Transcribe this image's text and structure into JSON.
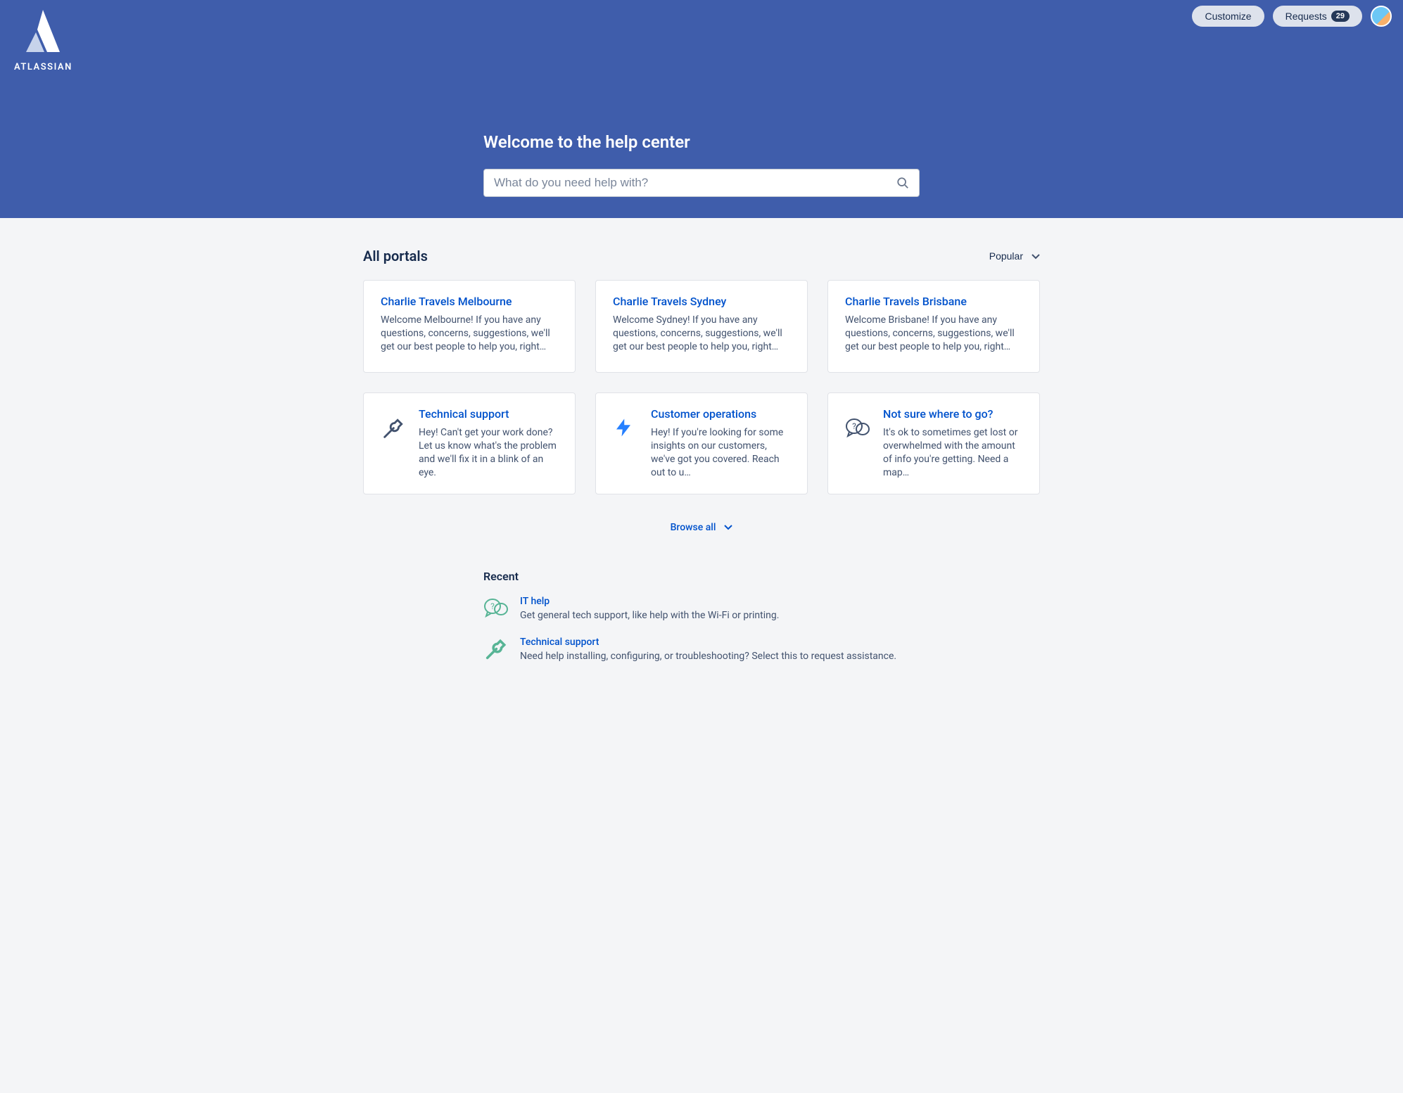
{
  "header": {
    "logo_text": "ATLASSIAN",
    "customize_label": "Customize",
    "requests_label": "Requests",
    "requests_count": "29"
  },
  "hero": {
    "title": "Welcome to the help center",
    "search_placeholder": "What do you need help with?"
  },
  "portals": {
    "heading": "All portals",
    "sort_label": "Popular",
    "browse_all_label": "Browse all",
    "cards": [
      {
        "title": "Charlie Travels Melbourne",
        "desc": "Welcome Melbourne! If you have any questions, concerns, suggestions, we'll get our best people to help you, right…"
      },
      {
        "title": "Charlie Travels Sydney",
        "desc": "Welcome Sydney! If you have any questions, concerns, suggestions, we'll get our best people to help you, right…"
      },
      {
        "title": "Charlie Travels Brisbane",
        "desc": "Welcome Brisbane! If you have any questions, concerns, suggestions, we'll get our best people to help you, right…"
      },
      {
        "title": "Technical support",
        "desc": "Hey! Can't get your work done? Let us know what's the problem and we'll fix it in a blink of an eye."
      },
      {
        "title": "Customer operations",
        "desc": "Hey! If you're looking for some insights on our customers, we've got you covered. Reach out to u…"
      },
      {
        "title": "Not sure where to go?",
        "desc": "It's ok to sometimes get lost or overwhelmed with the amount of info you're getting. Need a map…"
      }
    ]
  },
  "recent": {
    "heading": "Recent",
    "items": [
      {
        "title": "IT help",
        "desc": "Get general tech support, like help with the Wi-Fi or printing."
      },
      {
        "title": "Technical support",
        "desc": "Need help installing, configuring, or troubleshooting? Select this to request assistance."
      }
    ]
  }
}
